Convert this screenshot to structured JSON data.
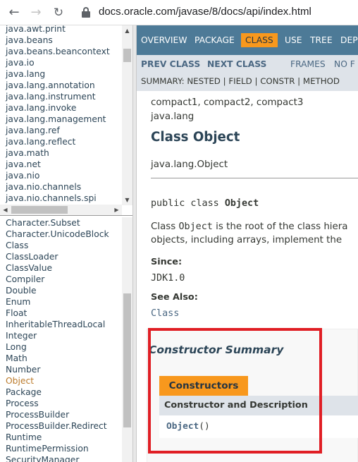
{
  "browser": {
    "url": "docs.oracle.com/javase/8/docs/api/index.html"
  },
  "packages": [
    "java.awt.print",
    "java.beans",
    "java.beans.beancontext",
    "java.io",
    "java.lang",
    "java.lang.annotation",
    "java.lang.instrument",
    "java.lang.invoke",
    "java.lang.management",
    "java.lang.ref",
    "java.lang.reflect",
    "java.math",
    "java.net",
    "java.nio",
    "java.nio.channels",
    "java.nio.channels.spi"
  ],
  "classes": [
    "Character.Subset",
    "Character.UnicodeBlock",
    "Class",
    "ClassLoader",
    "ClassValue",
    "Compiler",
    "Double",
    "Enum",
    "Float",
    "InheritableThreadLocal",
    "Integer",
    "Long",
    "Math",
    "Number",
    "Object",
    "Package",
    "Process",
    "ProcessBuilder",
    "ProcessBuilder.Redirect",
    "Runtime",
    "RuntimePermission",
    "SecurityManager"
  ],
  "active_class_index": 14,
  "topnav": {
    "overview": "OVERVIEW",
    "package": "PACKAGE",
    "class": "CLASS",
    "use": "USE",
    "tree": "TREE",
    "deprecated": "DEPR"
  },
  "subnav": {
    "prev": "PREV CLASS",
    "next": "NEXT CLASS",
    "frames": "FRAMES",
    "noframes": "NO F",
    "summary": "SUMMARY: NESTED | FIELD | CONSTR | METHOD"
  },
  "main": {
    "profiles": "compact1, compact2, compact3",
    "package": "java.lang",
    "title": "Class Object",
    "inheritance": "java.lang.Object",
    "decl_prefix": "public class ",
    "decl_name": "Object",
    "desc1_a": "Class ",
    "desc1_code": "Object",
    "desc1_b": " is the root of the class hiera",
    "desc2": "objects, including arrays, implement the",
    "since_label": "Since:",
    "since_value": "JDK1.0",
    "see_also_label": "See Also:",
    "see_also_value": "Class"
  },
  "constructor_summary": {
    "title": "Constructor Summary",
    "tab": "Constructors",
    "header": "Constructor and Description",
    "row_link": "Object",
    "row_suffix": "()"
  },
  "colors": {
    "nav_bg": "#4d7a97",
    "accent": "#f8981d",
    "subnav_bg": "#dee3e9",
    "highlight_box": "#e01e24",
    "link": "#4a6782"
  }
}
